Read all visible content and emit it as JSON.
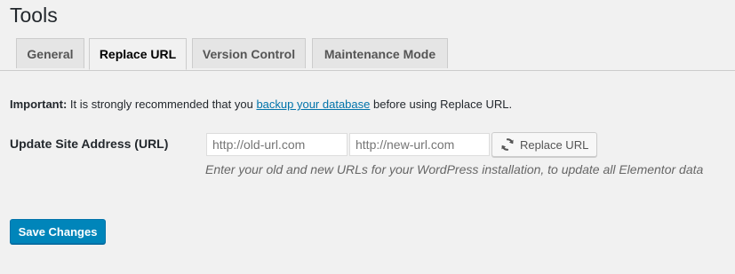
{
  "page": {
    "title": "Tools"
  },
  "tabs": [
    {
      "label": "General",
      "active": false
    },
    {
      "label": "Replace URL",
      "active": true
    },
    {
      "label": "Version Control",
      "active": false
    },
    {
      "label": "Maintenance Mode",
      "active": false
    }
  ],
  "notice": {
    "strong": "Important:",
    "before": " It is strongly recommended that you ",
    "link": "backup your database",
    "after": " before using Replace URL."
  },
  "replace_url": {
    "label": "Update Site Address (URL)",
    "old_placeholder": "http://old-url.com",
    "old_value": "",
    "new_placeholder": "http://new-url.com",
    "new_value": "",
    "button_label": "Replace URL",
    "button_icon": "refresh-icon",
    "description": "Enter your old and new URLs for your WordPress installation, to update all Elementor data"
  },
  "save_label": "Save Changes",
  "colors": {
    "background": "#f1f1f1",
    "link": "#0073aa",
    "primary_button": "#0085ba"
  }
}
